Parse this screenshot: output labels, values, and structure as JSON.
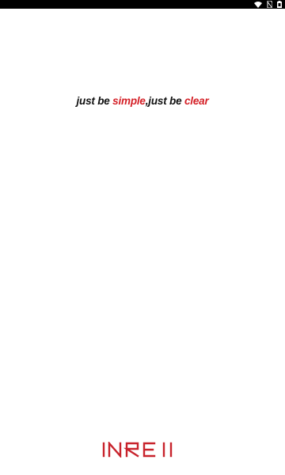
{
  "status_bar": {
    "icons": [
      "wifi-icon",
      "signal-no-sim-icon",
      "battery-icon"
    ]
  },
  "splash": {
    "slogan_part1": "just be ",
    "slogan_part2": "simple",
    "slogan_part3": ",just be ",
    "slogan_part4": "clear",
    "brand_name": "INREII"
  },
  "colors": {
    "accent": "#d41f26",
    "text": "#111111",
    "status_bar": "#000000",
    "background": "#ffffff"
  }
}
